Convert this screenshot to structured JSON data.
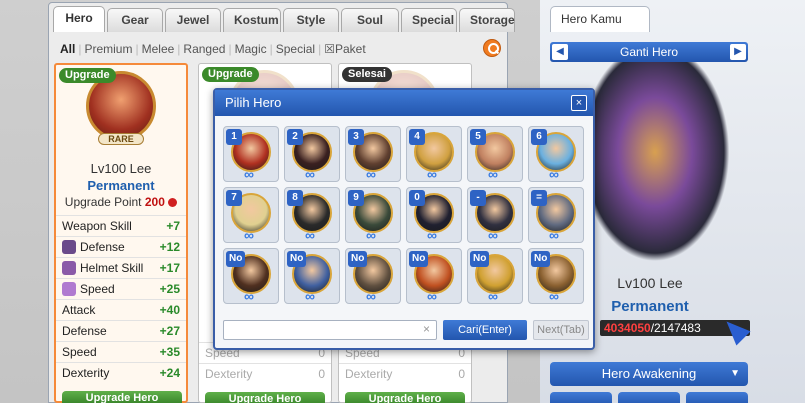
{
  "tabs": [
    "Hero",
    "Gear",
    "Jewel",
    "Kostum",
    "Style",
    "Soul",
    "Special",
    "Storage"
  ],
  "filters": [
    "All",
    "Premium",
    "Melee",
    "Ranged",
    "Magic",
    "Special",
    "Paket"
  ],
  "cards": [
    {
      "badge": "Upgrade",
      "rare": "RARE",
      "name": "Lv100 Lee",
      "status": "Permanent",
      "upgrade_label": "Upgrade Point",
      "upgrade_value": "200",
      "stats": [
        {
          "label": "Weapon Skill",
          "value": "+7"
        },
        {
          "label": "Defense",
          "value": "+12"
        },
        {
          "label": "Helmet Skill",
          "value": "+17"
        },
        {
          "label": "Speed",
          "value": "+25"
        },
        {
          "label": "Attack",
          "value": "+40"
        },
        {
          "label": "Defense",
          "value": "+27"
        },
        {
          "label": "Speed",
          "value": "+35"
        },
        {
          "label": "Dexterity",
          "value": "+24"
        }
      ],
      "button": "Upgrade Hero"
    },
    {
      "badge": "Upgrade",
      "stats": [
        {
          "label": "Speed",
          "value": "0"
        },
        {
          "label": "Dexterity",
          "value": "0"
        }
      ],
      "button": "Upgrade Hero"
    },
    {
      "badge": "Selesai",
      "stats": [
        {
          "label": "Speed",
          "value": "0"
        },
        {
          "label": "Dexterity",
          "value": "0"
        }
      ],
      "button": "Upgrade Hero"
    }
  ],
  "right": {
    "tab": "Hero Kamu",
    "ganti": "Ganti Hero",
    "name": "Lv100 Lee",
    "status": "Permanent",
    "exp_current": "4034050",
    "exp_total": "/2147483",
    "awaken": "Hero Awakening"
  },
  "dialog": {
    "title": "Pilih Hero",
    "close": "×",
    "heroes": [
      {
        "tag": "1",
        "color": "#b03020"
      },
      {
        "tag": "2",
        "color": "#3a2020"
      },
      {
        "tag": "3",
        "color": "#604030"
      },
      {
        "tag": "4",
        "color": "#d0a040"
      },
      {
        "tag": "5",
        "color": "#c08060"
      },
      {
        "tag": "6",
        "color": "#6ab0e0"
      },
      {
        "tag": "7",
        "color": "#e0d090"
      },
      {
        "tag": "8",
        "color": "#2a2a2a"
      },
      {
        "tag": "9",
        "color": "#3a4a3a"
      },
      {
        "tag": "0",
        "color": "#202030"
      },
      {
        "tag": "-",
        "color": "#303040"
      },
      {
        "tag": "=",
        "color": "#606a80"
      },
      {
        "tag": "No",
        "color": "#503020"
      },
      {
        "tag": "No",
        "color": "#4060a0"
      },
      {
        "tag": "No",
        "color": "#605040"
      },
      {
        "tag": "No",
        "color": "#c05020"
      },
      {
        "tag": "No",
        "color": "#d0a030"
      },
      {
        "tag": "No",
        "color": "#8a6030"
      }
    ],
    "infinity": "∞",
    "search_placeholder": "",
    "clear": "×",
    "search_button": "Cari(Enter)",
    "next_button": "Next(Tab)"
  }
}
